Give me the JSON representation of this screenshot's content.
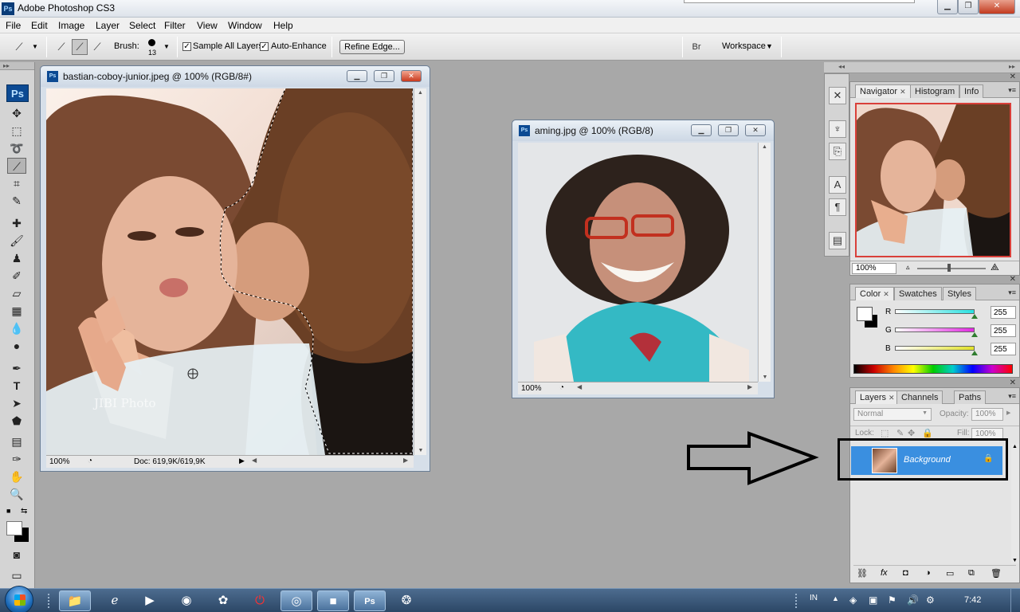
{
  "app": {
    "title": "Adobe Photoshop CS3",
    "logo": "Ps"
  },
  "menu": [
    "File",
    "Edit",
    "Image",
    "Layer",
    "Select",
    "Filter",
    "View",
    "Window",
    "Help"
  ],
  "options": {
    "brush_label": "Brush:",
    "brush_size": "13",
    "sample_all_layers": "Sample All Layers",
    "auto_enhance": "Auto-Enhance",
    "refine_edge": "Refine Edge...",
    "workspace": "Workspace"
  },
  "documents": [
    {
      "name": "bastian-coboy-junior.jpeg @ 100% (RGB/8#)",
      "zoom": "100%",
      "doc_info": "Doc: 619,9K/619,9K",
      "watermark": "JIBI Photo"
    },
    {
      "name": "aming.jpg @ 100% (RGB/8)",
      "zoom": "100%"
    }
  ],
  "navigator": {
    "tabs": [
      "Navigator",
      "Histogram",
      "Info"
    ],
    "zoom": "100%"
  },
  "color_panel": {
    "tabs": [
      "Color",
      "Swatches",
      "Styles"
    ],
    "channels": [
      {
        "label": "R",
        "value": "255",
        "level": 1.0,
        "color": "#29e1e1"
      },
      {
        "label": "G",
        "value": "255",
        "level": 1.0,
        "color": "#e129e1"
      },
      {
        "label": "B",
        "value": "255",
        "level": 1.0,
        "color": "#e1e129"
      }
    ]
  },
  "layers_panel": {
    "tabs": [
      "Layers",
      "Channels",
      "Paths"
    ],
    "blend_mode": "Normal",
    "opacity_label": "Opacity:",
    "opacity": "100%",
    "lock_label": "Lock:",
    "fill_label": "Fill:",
    "fill": "100%",
    "layer_name": "Background"
  },
  "taskbar": {
    "language": "IN",
    "time": "7:42"
  },
  "colors": {
    "accent": "#3a8fe0",
    "ps_blue": "#0c4a93"
  }
}
